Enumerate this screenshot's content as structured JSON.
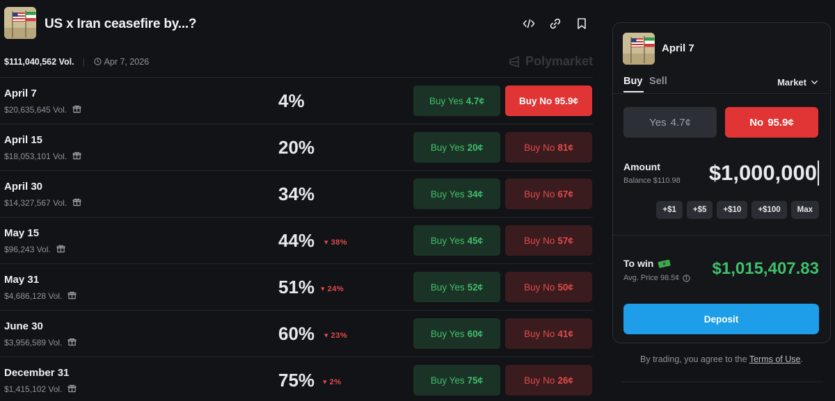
{
  "market": {
    "title": "US x Iran ceasefire by...?",
    "total_volume": "$111,040,562 Vol.",
    "date": "Apr 7, 2026",
    "brand": "Polymarket"
  },
  "header_icons": [
    "embed-code-icon",
    "link-icon",
    "bookmark-icon"
  ],
  "outcomes": [
    {
      "name": "April 7",
      "volume": "$20,635,645 Vol.",
      "prob": "4%",
      "change": "",
      "yes_label": "Buy Yes",
      "yes_price": "4.7¢",
      "no_label": "Buy No",
      "no_price": "95.9¢",
      "selected": true
    },
    {
      "name": "April 15",
      "volume": "$18,053,101 Vol.",
      "prob": "20%",
      "change": "",
      "yes_label": "Buy Yes",
      "yes_price": "20¢",
      "no_label": "Buy No",
      "no_price": "81¢"
    },
    {
      "name": "April 30",
      "volume": "$14,327,567 Vol.",
      "prob": "34%",
      "change": "",
      "yes_label": "Buy Yes",
      "yes_price": "34¢",
      "no_label": "Buy No",
      "no_price": "67¢"
    },
    {
      "name": "May 15",
      "volume": "$96,243 Vol.",
      "prob": "44%",
      "change": "▾ 38%",
      "yes_label": "Buy Yes",
      "yes_price": "45¢",
      "no_label": "Buy No",
      "no_price": "57¢"
    },
    {
      "name": "May 31",
      "volume": "$4,686,128 Vol.",
      "prob": "51%",
      "change": "▾ 24%",
      "yes_label": "Buy Yes",
      "yes_price": "52¢",
      "no_label": "Buy No",
      "no_price": "50¢"
    },
    {
      "name": "June 30",
      "volume": "$3,956,589 Vol.",
      "prob": "60%",
      "change": "▾ 23%",
      "yes_label": "Buy Yes",
      "yes_price": "60¢",
      "no_label": "Buy No",
      "no_price": "41¢"
    },
    {
      "name": "December 31",
      "volume": "$1,415,102 Vol.",
      "prob": "75%",
      "change": "▾ 2%",
      "yes_label": "Buy Yes",
      "yes_price": "75¢",
      "no_label": "Buy No",
      "no_price": "26¢"
    }
  ],
  "panel": {
    "title": "April 7",
    "tab_buy": "Buy",
    "tab_sell": "Sell",
    "order_type": "Market",
    "yes_label": "Yes",
    "yes_price": "4.7¢",
    "no_label": "No",
    "no_price": "95.9¢",
    "amount_label": "Amount",
    "balance": "Balance $110.98",
    "amount_value": "$1,000,000",
    "quick_amounts": [
      "+$1",
      "+$5",
      "+$10",
      "+$100",
      "Max"
    ],
    "to_win_label": "To win",
    "avg_price": "Avg. Price 98.5¢",
    "to_win_value": "$1,015,407.83",
    "deposit_label": "Deposit",
    "terms_prefix": "By trading, you agree to the",
    "terms_link": "Terms of Use",
    "terms_suffix": "."
  },
  "colors": {
    "yes": "#3fbf6a",
    "no": "#e24b4b",
    "no_active": "#e13535",
    "deposit": "#1e9ee8",
    "background": "#121316"
  }
}
